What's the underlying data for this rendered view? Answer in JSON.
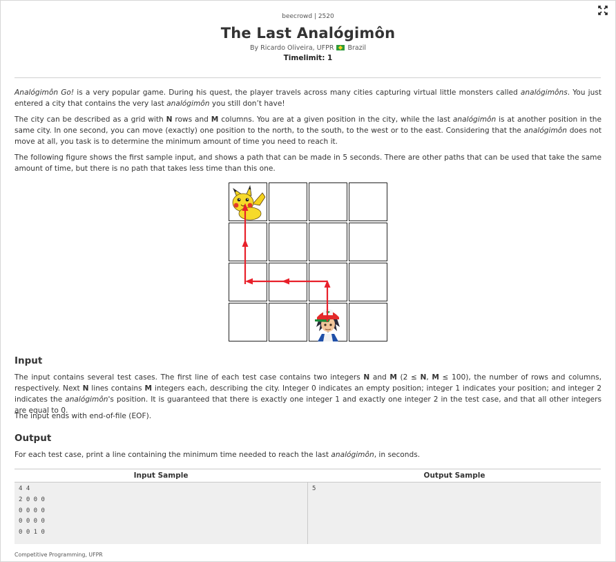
{
  "header": {
    "source": "beecrowd | 2520",
    "title": "The Last Analógimôn",
    "author_prefix": "By Ricardo Oliveira, UFPR",
    "country": "Brazil",
    "timelimit": "Timelimit: 1"
  },
  "icons": {
    "expand": "expand-icon",
    "flag": "brazil-flag-icon",
    "pikachu": "pikachu-sprite",
    "ash": "ash-sprite"
  },
  "colors": {
    "arrow": "#e8202a",
    "flag_green": "#2e9a3a",
    "flag_yellow": "#f5d423"
  },
  "statement": {
    "p1": {
      "a": "Analógimôn Go!",
      "b": " is a very popular game. During his quest, the player travels across many cities capturing virtual little monsters called ",
      "c": "analógimôns",
      "d": ". You just entered a city that contains the very last ",
      "e": "analógimôn",
      "f": " you still don’t have!"
    },
    "p2": {
      "a": "The city can be described as a grid with ",
      "b": "N",
      "c": " rows and ",
      "d": "M",
      "e": " columns. You are at a given position in the city, while the last ",
      "f": "analógimôn",
      "g": " is at another position in the same city. In one second, you can move (exactly) one position to the north, to the south, to the west or to the east. Considering that the ",
      "h": "analógimôn",
      "i": " does not move at all, you task is to determine the minimum amount of time you need to reach it."
    },
    "p3": "The following figure shows the first sample input, and shows a path that can be made in 5 seconds. There are other paths that can be used that take the same amount of time, but there is no path that takes less time than this one."
  },
  "input": {
    "heading": "Input",
    "p1": {
      "a": "The input contains several test cases. The first line of each test case contains two integers ",
      "b": "N",
      "c": " and ",
      "d": "M",
      "e": " (2 ≤ ",
      "f": "N",
      "g": ", ",
      "h": "M",
      "i": " ≤ 100), the number of rows and columns, respectively. Next ",
      "j": "N",
      "k": " lines contains ",
      "l": "M",
      "m": " integers each, describing the city. Integer 0 indicates an empty position; integer 1 indicates your position; and integer 2 indicates the ",
      "n": "analógimôn",
      "o": "'s position. It is guaranteed that there is exactly one integer 1 and exactly one integer 2 in the test case, and that all other integers are equal to 0."
    },
    "p2": "The input ends with end-of-file (EOF)."
  },
  "output": {
    "heading": "Output",
    "p1": {
      "a": "For each test case, print a line containing the minimum time needed to reach the last ",
      "b": "analógimôn",
      "c": ", in seconds."
    }
  },
  "samples": {
    "input_label": "Input Sample",
    "output_label": "Output Sample",
    "input_text": "4 4\n2 0 0 0\n0 0 0 0\n0 0 0 0\n0 0 1 0",
    "output_text": "5"
  },
  "footer": "Competitive Programming, UFPR"
}
